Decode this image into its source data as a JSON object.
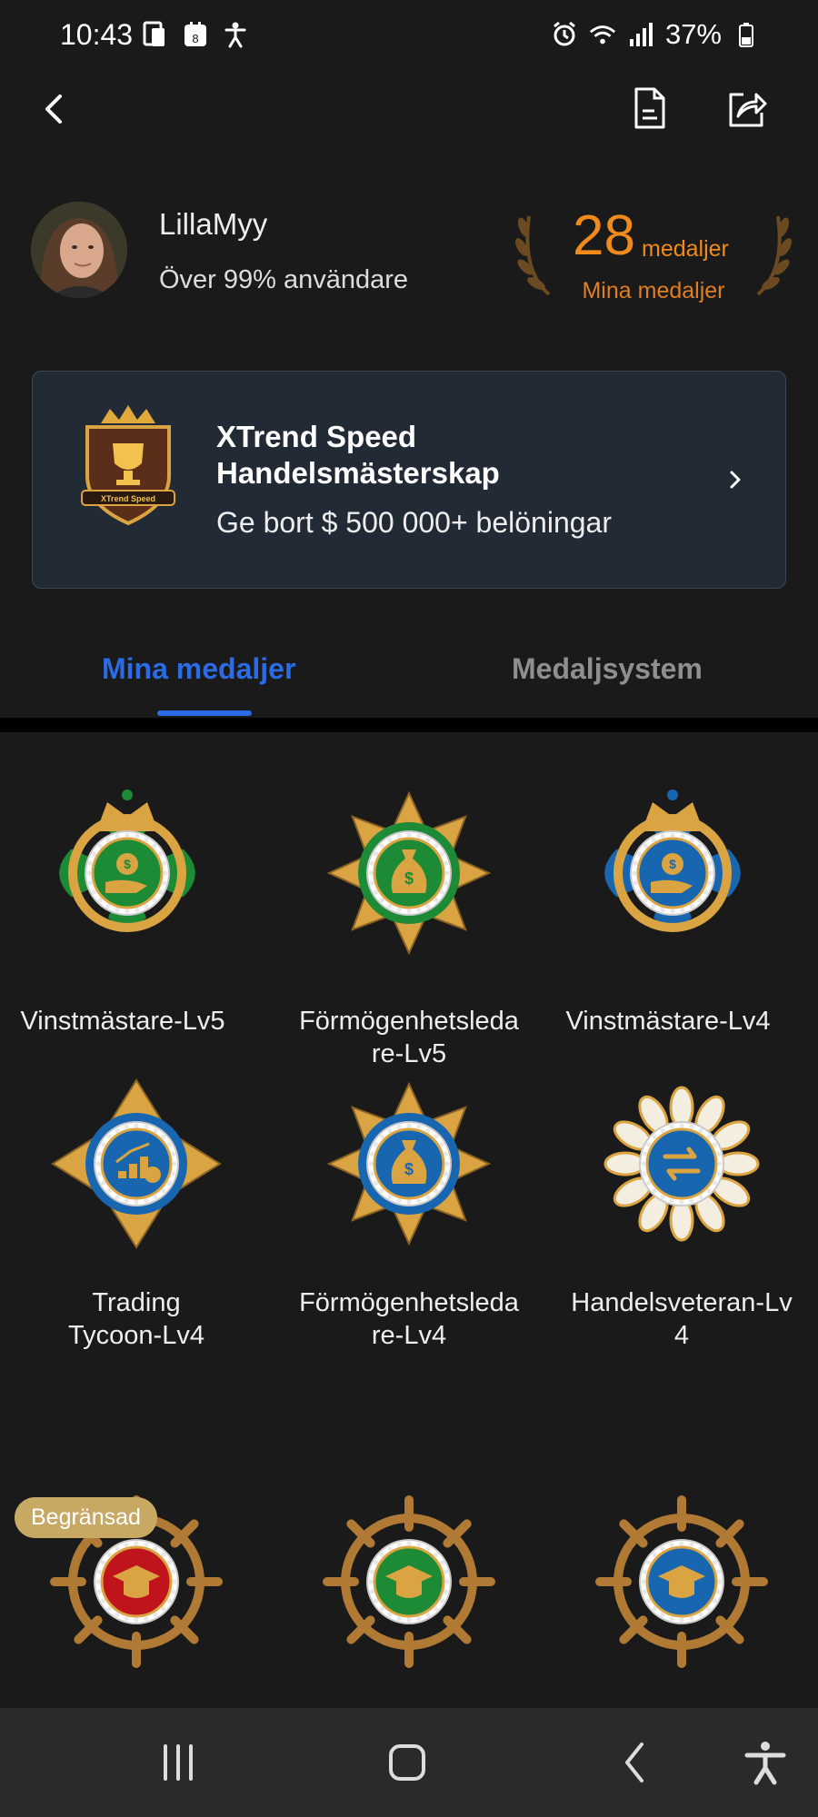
{
  "status_bar": {
    "time": "10:43",
    "battery": "37%",
    "icons_left": [
      "device-icon",
      "calendar-icon",
      "accessibility-icon"
    ],
    "icons_right": [
      "alarm-icon",
      "wifi-icon",
      "signal-icon",
      "battery-icon"
    ]
  },
  "app_bar": {
    "icons": [
      "back-icon",
      "document-icon",
      "share-icon"
    ]
  },
  "profile": {
    "username": "LillaMyy",
    "rank": "Över 99% användare",
    "medal_count": "28",
    "medal_unit": "medaljer",
    "medal_caption": "Mina medaljer"
  },
  "banner": {
    "title_line1": "XTrend Speed",
    "title_line2": "Handelsmästerskap",
    "subtitle": "Ge bort $ 500 000+ belöningar",
    "logo_text": "XTrend Speed"
  },
  "tabs": [
    {
      "label": "Mina medaljer",
      "active": true
    },
    {
      "label": "Medaljsystem",
      "active": false
    }
  ],
  "medals": [
    {
      "name_line1": "Vinstmästare-Lv5",
      "name_line2": "",
      "icon": "hand-coin-icon",
      "accent": "#1d8a36"
    },
    {
      "name_line1": "Förmögenhetsleda",
      "name_line2": "re-Lv5",
      "icon": "money-bag-icon",
      "accent": "#1d8a36"
    },
    {
      "name_line1": "Vinstmästare-Lv4",
      "name_line2": "",
      "icon": "hand-coin-icon",
      "accent": "#1966b0"
    },
    {
      "name_line1": "Trading",
      "name_line2": "Tycoon-Lv4",
      "icon": "chart-coin-icon",
      "accent": "#1966b0"
    },
    {
      "name_line1": "Förmögenhetsleda",
      "name_line2": "re-Lv4",
      "icon": "money-bag-icon",
      "accent": "#1966b0"
    },
    {
      "name_line1": "Handelsveteran-Lv",
      "name_line2": "4",
      "icon": "exchange-arrows-icon",
      "accent": "#1966b0"
    },
    {
      "name_line1": "",
      "name_line2": "",
      "icon": "graduation-cap-icon",
      "accent": "#c0141c"
    },
    {
      "name_line1": "",
      "name_line2": "",
      "icon": "graduation-cap-icon",
      "accent": "#1d8a36"
    },
    {
      "name_line1": "",
      "name_line2": "",
      "icon": "graduation-cap-icon",
      "accent": "#1966b0"
    }
  ],
  "limited_badge": "Begränsad",
  "colors": {
    "background": "#1a1a1a",
    "accent_orange": "#f08a1a",
    "tab_active": "#2b6be6",
    "tab_inactive": "#8f8f8f",
    "banner_bg": "#222a36",
    "gold": "#d9a441"
  },
  "nav_bar": {
    "icons": [
      "recent-apps-icon",
      "home-icon",
      "back-nav-icon",
      "accessibility-nav-icon"
    ]
  }
}
